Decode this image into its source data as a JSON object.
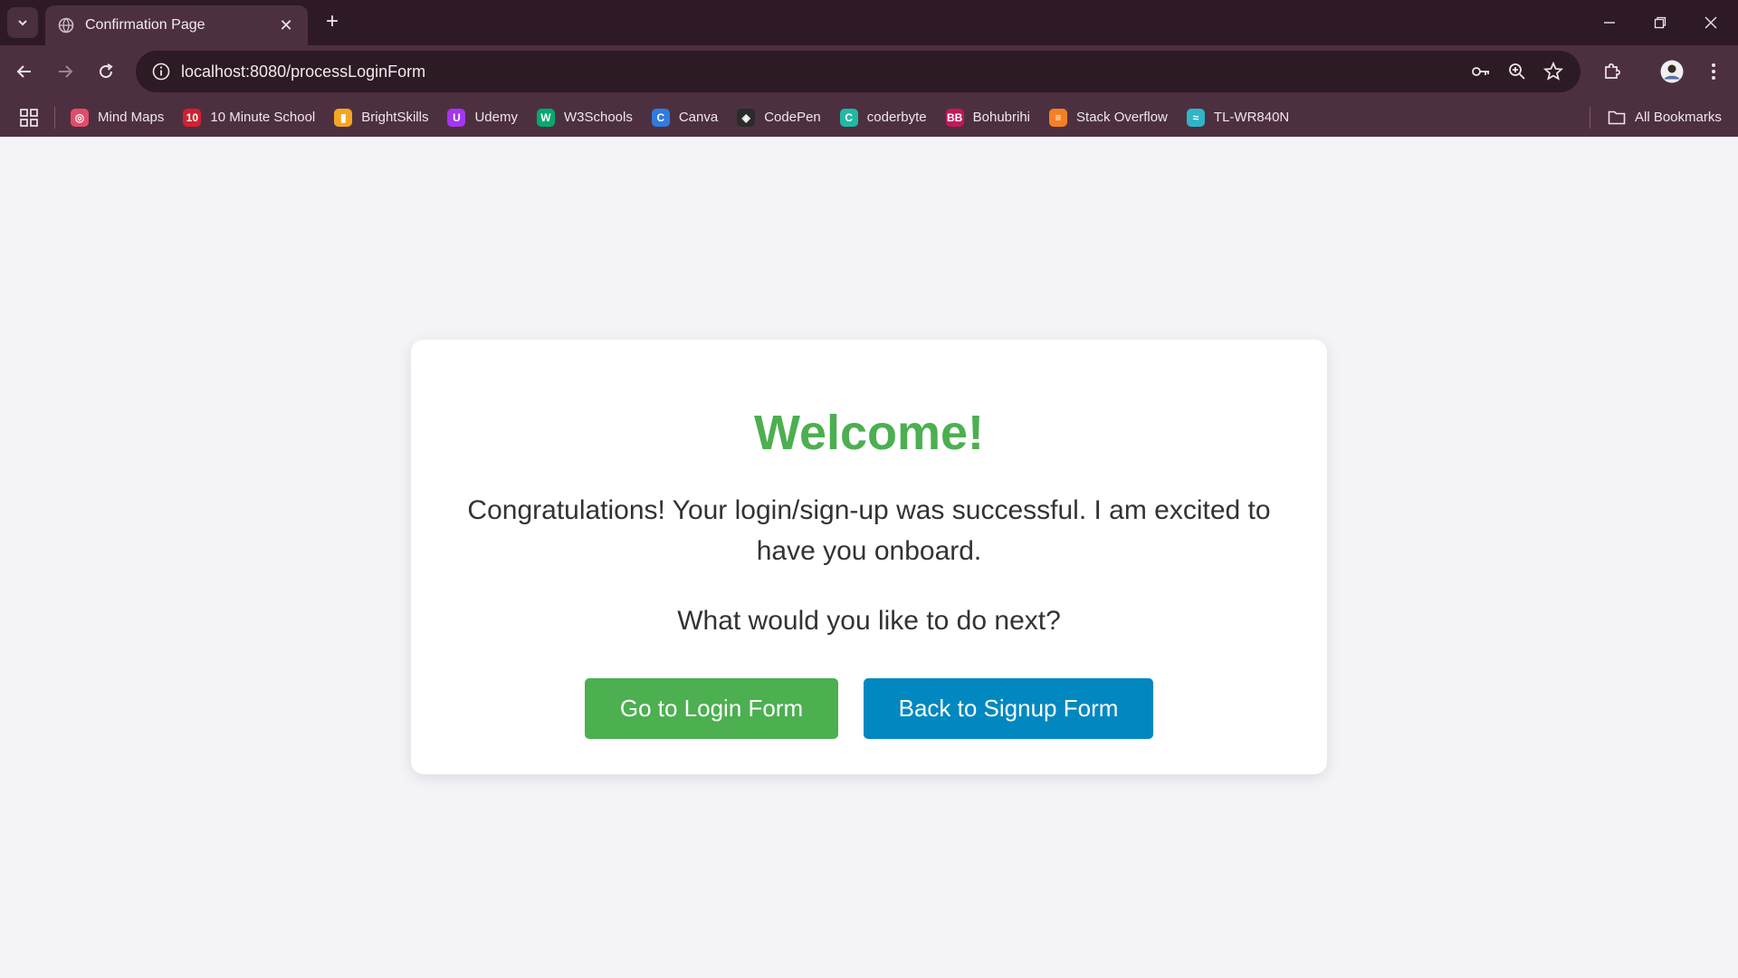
{
  "browser": {
    "tab": {
      "title": "Confirmation Page"
    },
    "address_bar": {
      "url": "localhost:8080/processLoginForm"
    },
    "bookmarks": [
      {
        "label": "Mind Maps",
        "icon": "mindmaps-icon",
        "color": "#e34b6b"
      },
      {
        "label": "10 Minute School",
        "icon": "ten-minute-school-icon",
        "color": "#d3202f"
      },
      {
        "label": "BrightSkills",
        "icon": "brightskills-icon",
        "color": "#f5a623"
      },
      {
        "label": "Udemy",
        "icon": "udemy-icon",
        "color": "#a435f0"
      },
      {
        "label": "W3Schools",
        "icon": "w3schools-icon",
        "color": "#04aa6d"
      },
      {
        "label": "Canva",
        "icon": "canva-icon",
        "color": "#2f7ce0"
      },
      {
        "label": "CodePen",
        "icon": "codepen-icon",
        "color": "#2b2b2b"
      },
      {
        "label": "coderbyte",
        "icon": "coderbyte-icon",
        "color": "#22b8a5"
      },
      {
        "label": "Bohubrihi",
        "icon": "bohubrihi-icon",
        "color": "#c2185b"
      },
      {
        "label": "Stack Overflow",
        "icon": "stackoverflow-icon",
        "color": "#f48024"
      },
      {
        "label": "TL-WR840N",
        "icon": "tplink-icon",
        "color": "#2fb5c8"
      }
    ],
    "all_bookmarks_label": "All Bookmarks"
  },
  "page": {
    "heading": "Welcome!",
    "message": "Congratulations! Your login/sign-up was successful. I am excited to have you onboard.",
    "prompt": "What would you like to do next?",
    "buttons": {
      "login": "Go to Login Form",
      "signup": "Back to Signup Form"
    }
  },
  "colors": {
    "heading": "#4caf50",
    "login_button": "#4caf50",
    "signup_button": "#0288c0"
  }
}
